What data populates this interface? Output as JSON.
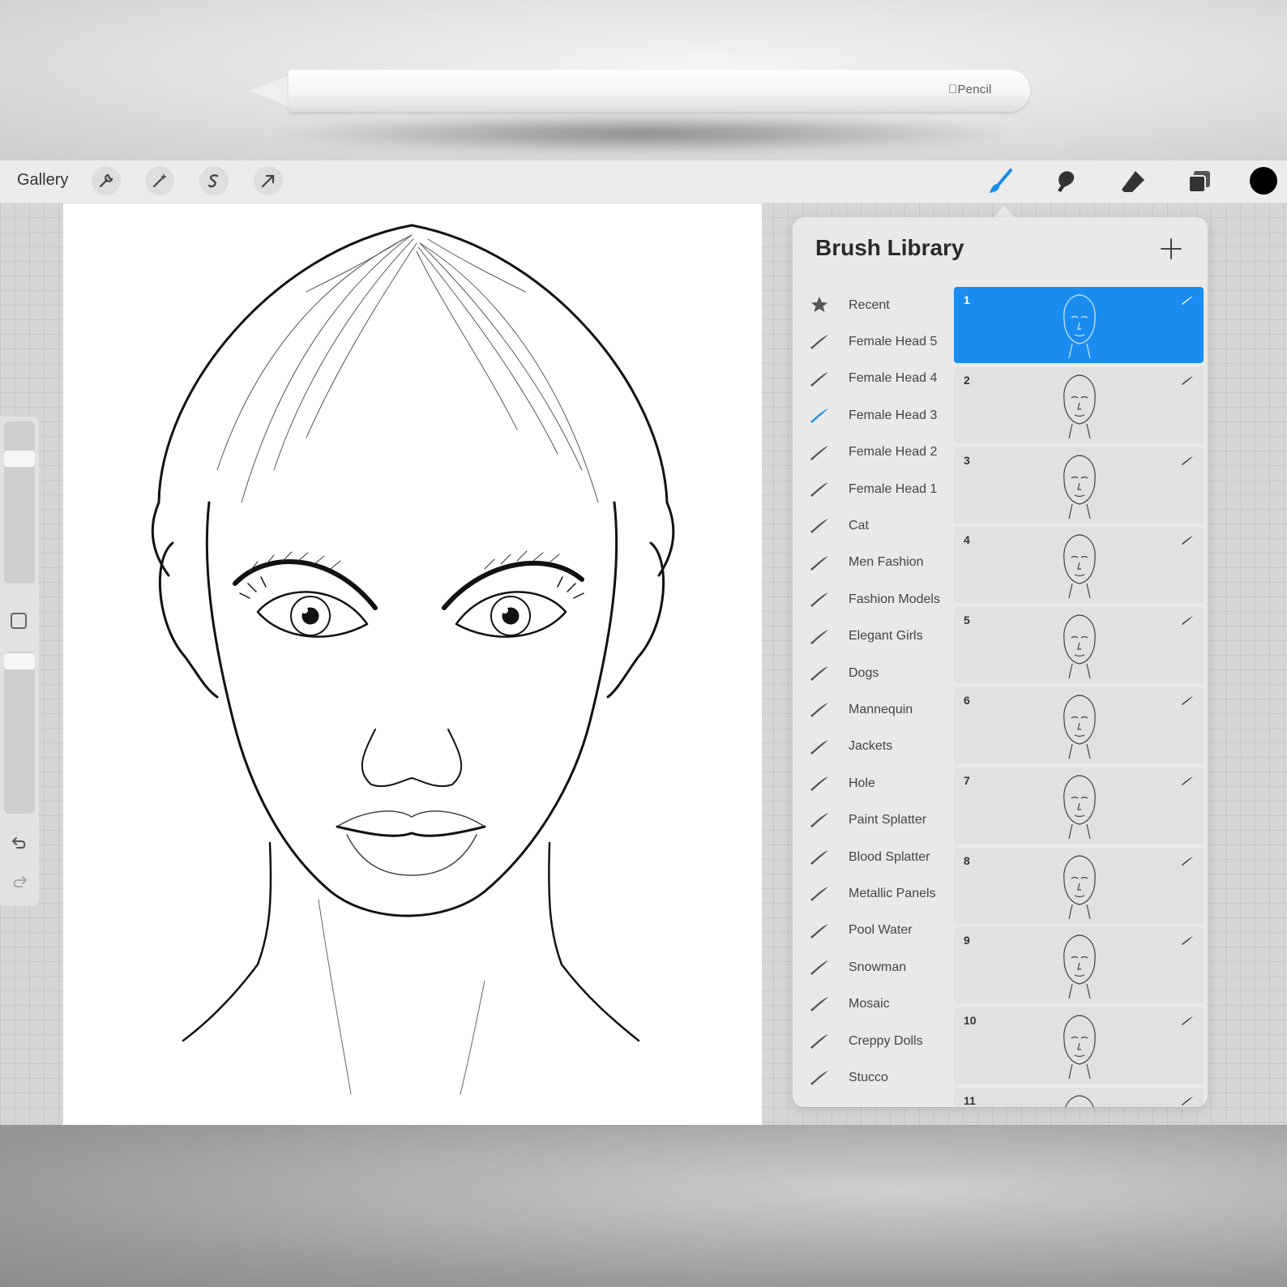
{
  "device": {
    "pencil_brand": "Pencil"
  },
  "toolbar": {
    "gallery_label": "Gallery",
    "left_tools": [
      "wrench-icon",
      "magic-wand-icon",
      "selection-s-icon",
      "transform-arrow-icon"
    ],
    "right_tools": [
      "brush-icon",
      "smudge-icon",
      "eraser-icon",
      "layers-icon"
    ],
    "active_tool": "brush-icon",
    "active_color": "#000000",
    "accent_color": "#1a8cf0"
  },
  "brush_library": {
    "title": "Brush Library",
    "add_icon": "plus-icon",
    "categories": [
      {
        "label": "Recent",
        "icon": "star-icon"
      },
      {
        "label": "Female Head 5",
        "icon": "brush-stroke-icon"
      },
      {
        "label": "Female Head 4",
        "icon": "brush-stroke-icon"
      },
      {
        "label": "Female Head 3",
        "icon": "brush-stroke-icon",
        "active": true
      },
      {
        "label": "Female Head 2",
        "icon": "brush-stroke-icon"
      },
      {
        "label": "Female Head 1",
        "icon": "brush-stroke-icon"
      },
      {
        "label": "Cat",
        "icon": "brush-stroke-icon"
      },
      {
        "label": "Men Fashion",
        "icon": "brush-stroke-icon"
      },
      {
        "label": "Fashion Models",
        "icon": "brush-stroke-icon"
      },
      {
        "label": "Elegant Girls",
        "icon": "brush-stroke-icon"
      },
      {
        "label": "Dogs",
        "icon": "brush-stroke-icon"
      },
      {
        "label": "Mannequin",
        "icon": "brush-stroke-icon"
      },
      {
        "label": "Jackets",
        "icon": "brush-stroke-icon"
      },
      {
        "label": "Hole",
        "icon": "brush-stroke-icon"
      },
      {
        "label": "Paint Splatter",
        "icon": "brush-stroke-icon"
      },
      {
        "label": "Blood Splatter",
        "icon": "brush-stroke-icon"
      },
      {
        "label": "Metallic Panels",
        "icon": "brush-stroke-icon"
      },
      {
        "label": "Pool Water",
        "icon": "brush-stroke-icon"
      },
      {
        "label": "Snowman",
        "icon": "brush-stroke-icon"
      },
      {
        "label": "Mosaic",
        "icon": "brush-stroke-icon"
      },
      {
        "label": "Creppy Dolls",
        "icon": "brush-stroke-icon"
      },
      {
        "label": "Stucco",
        "icon": "brush-stroke-icon"
      }
    ],
    "brushes": [
      {
        "number": "1",
        "active": true
      },
      {
        "number": "2"
      },
      {
        "number": "3"
      },
      {
        "number": "4"
      },
      {
        "number": "5"
      },
      {
        "number": "6"
      },
      {
        "number": "7"
      },
      {
        "number": "8"
      },
      {
        "number": "9"
      },
      {
        "number": "10"
      },
      {
        "number": "11"
      }
    ]
  },
  "sidebar": {
    "icons": [
      "modify-square-icon",
      "undo-icon",
      "redo-icon"
    ],
    "brush_size": 0.95,
    "opacity": 0.95
  }
}
